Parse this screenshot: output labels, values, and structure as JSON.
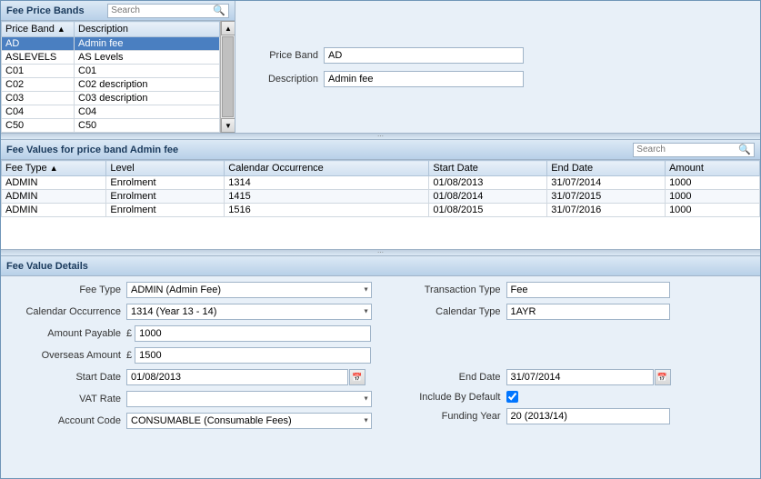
{
  "topSearchPlaceholder": "Search",
  "midSearchPlaceholder": "Search",
  "feePriceBandsTitle": "Fee Price Bands",
  "feeValuesTitle": "Fee Values for price band Admin fee",
  "feeValueDetailsTitle": "Fee Value Details",
  "priceBandLabel": "Price Band",
  "descriptionLabel": "Description",
  "priceBandValue": "AD",
  "descriptionValue": "Admin fee",
  "bandsTableHeaders": [
    "Price Band",
    "Description"
  ],
  "bandsRows": [
    {
      "band": "AD",
      "description": "Admin fee",
      "selected": true
    },
    {
      "band": "ASLEVELS",
      "description": "AS Levels",
      "selected": false
    },
    {
      "band": "C01",
      "description": "C01",
      "selected": false
    },
    {
      "band": "C02",
      "description": "C02 description",
      "selected": false
    },
    {
      "band": "C03",
      "description": "C03 description",
      "selected": false
    },
    {
      "band": "C04",
      "description": "C04",
      "selected": false
    },
    {
      "band": "C50",
      "description": "C50",
      "selected": false
    }
  ],
  "feeValuesHeaders": [
    "Fee Type",
    "Level",
    "Calendar Occurrence",
    "Start Date",
    "End Date",
    "Amount"
  ],
  "feeValuesRows": [
    {
      "feeType": "ADMIN",
      "level": "Enrolment",
      "calOcc": "1314",
      "startDate": "01/08/2013",
      "endDate": "31/07/2014",
      "amount": "1000"
    },
    {
      "feeType": "ADMIN",
      "level": "Enrolment",
      "calOcc": "1415",
      "startDate": "01/08/2014",
      "endDate": "31/07/2015",
      "amount": "1000"
    },
    {
      "feeType": "ADMIN",
      "level": "Enrolment",
      "calOcc": "1516",
      "startDate": "01/08/2015",
      "endDate": "31/07/2016",
      "amount": "1000"
    }
  ],
  "details": {
    "feeTypeLabel": "Fee Type",
    "feeTypeValue": "ADMIN (Admin Fee)",
    "calOccLabel": "Calendar Occurrence",
    "calOccValue": "1314 (Year 13 - 14)",
    "amountPayableLabel": "Amount Payable",
    "amountPayableValue": "1000",
    "overseasAmountLabel": "Overseas Amount",
    "overseasAmountValue": "1500",
    "startDateLabel": "Start Date",
    "startDateValue": "01/08/2013",
    "endDateLabel": "End Date",
    "endDateValue": "31/07/2014",
    "vatRateLabel": "VAT Rate",
    "vatRateValue": "",
    "includeByDefaultLabel": "Include By Default",
    "accountCodeLabel": "Account Code",
    "accountCodeValue": "CONSUMABLE (Consumable Fees)",
    "fundingYearLabel": "Funding Year",
    "fundingYearValue": "20 (2013/14)",
    "transactionTypeLabel": "Transaction Type",
    "transactionTypeValue": "Fee",
    "calendarTypeLabel": "Calendar Type",
    "calendarTypeValue": "1AYR"
  }
}
